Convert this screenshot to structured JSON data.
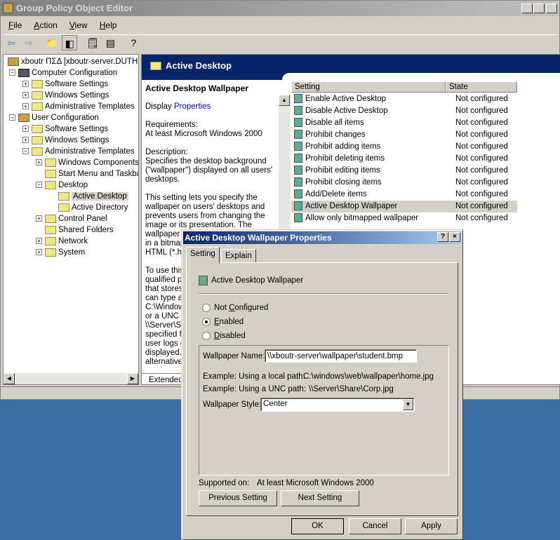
{
  "window": {
    "title": "Group Policy Object Editor"
  },
  "menu": [
    {
      "label": "File",
      "key": "F",
      "rest": "ile"
    },
    {
      "label": "Action",
      "key": "A",
      "rest": "ction"
    },
    {
      "label": "View",
      "key": "V",
      "rest": "iew"
    },
    {
      "label": "Help",
      "key": "H",
      "rest": "elp"
    }
  ],
  "tree": {
    "items": [
      {
        "label": "xboutr ΠΣΔ [xboutr-server.DUTH.l",
        "depth": 0,
        "expander": "",
        "icon": "policy"
      },
      {
        "label": "Computer Configuration",
        "depth": 1,
        "expander": "−",
        "icon": "computer"
      },
      {
        "label": "Software Settings",
        "depth": 2,
        "expander": "+",
        "icon": "folder"
      },
      {
        "label": "Windows Settings",
        "depth": 2,
        "expander": "+",
        "icon": "folder"
      },
      {
        "label": "Administrative Templates",
        "depth": 2,
        "expander": "+",
        "icon": "folder"
      },
      {
        "label": "User Configuration",
        "depth": 1,
        "expander": "−",
        "icon": "user"
      },
      {
        "label": "Software Settings",
        "depth": 2,
        "expander": "+",
        "icon": "folder"
      },
      {
        "label": "Windows Settings",
        "depth": 2,
        "expander": "+",
        "icon": "folder"
      },
      {
        "label": "Administrative Templates",
        "depth": 2,
        "expander": "−",
        "icon": "folder"
      },
      {
        "label": "Windows Components",
        "depth": 3,
        "expander": "+",
        "icon": "folder"
      },
      {
        "label": "Start Menu and Taskba",
        "depth": 3,
        "expander": "",
        "icon": "folder"
      },
      {
        "label": "Desktop",
        "depth": 3,
        "expander": "−",
        "icon": "folder"
      },
      {
        "label": "Active Desktop",
        "depth": 4,
        "expander": "",
        "icon": "folder",
        "selected": true
      },
      {
        "label": "Active Directory",
        "depth": 4,
        "expander": "",
        "icon": "folder"
      },
      {
        "label": "Control Panel",
        "depth": 3,
        "expander": "+",
        "icon": "folder"
      },
      {
        "label": "Shared Folders",
        "depth": 3,
        "expander": "",
        "icon": "folder"
      },
      {
        "label": "Network",
        "depth": 3,
        "expander": "+",
        "icon": "folder"
      },
      {
        "label": "System",
        "depth": 3,
        "expander": "+",
        "icon": "folder"
      }
    ]
  },
  "right": {
    "header": "Active Desktop",
    "desc": {
      "title": "Active Desktop Wallpaper",
      "display": "Display",
      "properties_link": "Properties",
      "requirements_label": "Requirements:",
      "requirements": "At least Microsoft Windows 2000",
      "description_label": "Description:",
      "description": "Specifies the desktop background (\"wallpaper\") displayed on all users' desktops.",
      "para2": "This setting lets you specify the wallpaper on users' desktops and prevents users from changing the image or its presentation. The",
      "para2_clipped": [
        "wallpaper y",
        "in a bitmap",
        "HTML (*.ht"
      ],
      "para3_clipped": [
        "To use this",
        "qualified pa",
        "that stores",
        "can type a",
        "C:\\Window",
        "or a UNC p",
        "\\\\Server\\Sl",
        "specified fi",
        "user logs o",
        "displayed.",
        "alternative"
      ]
    },
    "tab_extended": "Extended",
    "columns": [
      "Setting",
      "State"
    ],
    "rows": [
      {
        "setting": "Enable Active Desktop",
        "state": "Not configured"
      },
      {
        "setting": "Disable Active Desktop",
        "state": "Not configured"
      },
      {
        "setting": "Disable all items",
        "state": "Not configured"
      },
      {
        "setting": "Prohibit changes",
        "state": "Not configured"
      },
      {
        "setting": "Prohibit adding items",
        "state": "Not configured"
      },
      {
        "setting": "Prohibit deleting items",
        "state": "Not configured"
      },
      {
        "setting": "Prohibit editing items",
        "state": "Not configured"
      },
      {
        "setting": "Prohibit closing items",
        "state": "Not configured"
      },
      {
        "setting": "Add/Delete items",
        "state": "Not configured"
      },
      {
        "setting": "Active Desktop Wallpaper",
        "state": "Not configured",
        "selected": true
      },
      {
        "setting": "Allow only bitmapped wallpaper",
        "state": "Not configured"
      }
    ]
  },
  "dialog": {
    "title": "Active Desktop Wallpaper Properties",
    "tabs": [
      "Setting",
      "Explain"
    ],
    "policy_name": "Active Desktop Wallpaper",
    "radios": [
      {
        "pre": "Not ",
        "key": "C",
        "rest": "onfigured",
        "checked": false
      },
      {
        "pre": "",
        "key": "E",
        "rest": "nabled",
        "checked": true
      },
      {
        "pre": "",
        "key": "D",
        "rest": "isabled",
        "checked": false
      }
    ],
    "wallpaper_name_label": "Wallpaper Name:",
    "wallpaper_name": "\\\\xboutr-server\\wallpaper\\student.bmp",
    "example_local_label": "Example: Using a local path:",
    "example_local": "C:\\windows\\web\\wallpaper\\home.jpg",
    "example_unc_label": "Example: Using a UNC path:",
    "example_unc": "\\\\Server\\Share\\Corp.jpg",
    "style_label": "Wallpaper Style:",
    "style": "Center",
    "supported_label": "Supported on:",
    "supported": "At least Microsoft Windows 2000",
    "prev": "Previous Setting",
    "next": "Next Setting",
    "ok": "OK",
    "cancel": "Cancel",
    "apply": "Apply"
  }
}
